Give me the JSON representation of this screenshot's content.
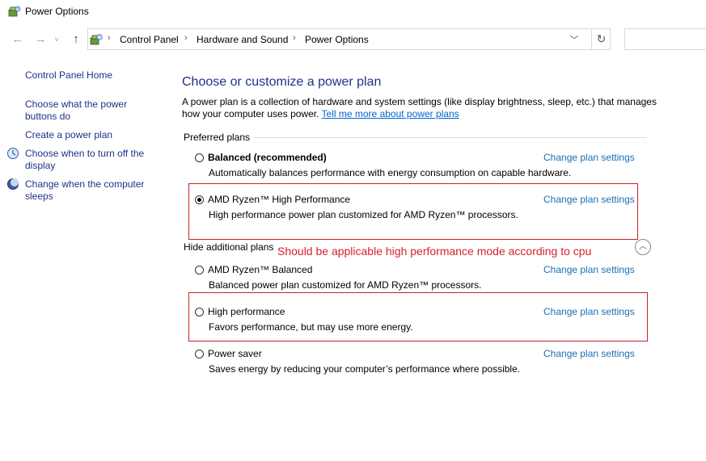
{
  "window": {
    "title": "Power Options",
    "icon": "power-options-icon"
  },
  "nav": {
    "back_icon": "back-arrow-icon",
    "forward_icon": "forward-arrow-icon",
    "recent_icon": "chevron-down-icon",
    "up_icon": "up-arrow-icon"
  },
  "address": {
    "crumbs": [
      "Control Panel",
      "Hardware and Sound",
      "Power Options"
    ],
    "dropdown_icon": "chevron-down-icon",
    "refresh_icon": "refresh-icon"
  },
  "sidebar": {
    "items": [
      {
        "label": "Control Panel Home"
      },
      {
        "label_line1": "Choose what the power",
        "label_line2": "buttons do"
      },
      {
        "label": "Create a power plan"
      },
      {
        "label_line1": "Choose when to turn off the",
        "label_line2": "display",
        "icon": "monitor-icon"
      },
      {
        "label_line1": "Change when the computer",
        "label_line2": "sleeps",
        "icon": "moon-icon"
      }
    ]
  },
  "main": {
    "heading": "Choose or customize a power plan",
    "description": "A power plan is a collection of hardware and system settings (like display brightness, sleep, etc.) that manages how your computer uses power.",
    "learn_more_link": "Tell me more about power plans",
    "preferred_label": "Preferred plans",
    "hide_additional_label": "Hide additional plans",
    "annotation": "Should be applicable high performance mode according to cpu",
    "change_settings_label": "Change plan settings",
    "preferred_plans": [
      {
        "name": "Balanced (recommended)",
        "description": "Automatically balances performance with energy consumption on capable hardware.",
        "selected": false
      },
      {
        "name": "AMD Ryzen™ High Performance",
        "description": "High performance power plan customized for AMD Ryzen™ processors.",
        "selected": true
      }
    ],
    "additional_plans": [
      {
        "name": "AMD Ryzen™ Balanced",
        "description": "Balanced power plan customized for AMD Ryzen™ processors.",
        "selected": false
      },
      {
        "name": "High performance",
        "description": "Favors performance, but may use more energy.",
        "selected": false
      },
      {
        "name": "Power saver",
        "description": "Saves energy by reducing your computer’s performance where possible.",
        "selected": false
      }
    ]
  }
}
